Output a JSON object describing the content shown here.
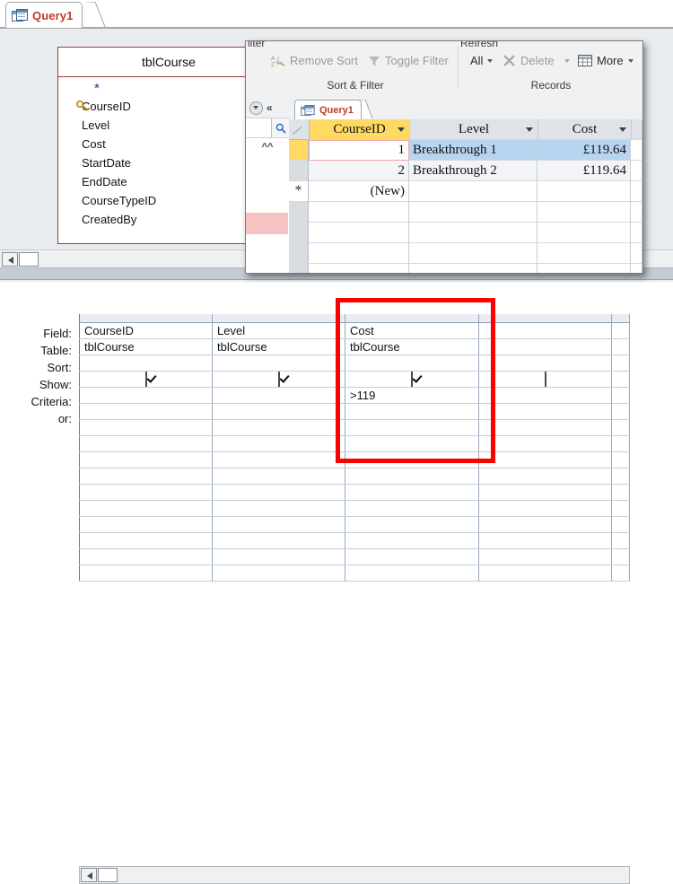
{
  "document_tab": {
    "label": "Query1",
    "icon": "query-icon"
  },
  "field_list": {
    "title": "tblCourse",
    "star": "*",
    "fields": [
      {
        "name": "CourseID",
        "primary_key": true
      },
      {
        "name": "Level",
        "primary_key": false
      },
      {
        "name": "Cost",
        "primary_key": false
      },
      {
        "name": "StartDate",
        "primary_key": false
      },
      {
        "name": "EndDate",
        "primary_key": false
      },
      {
        "name": "CourseTypeID",
        "primary_key": false
      },
      {
        "name": "CreatedBy",
        "primary_key": false
      }
    ]
  },
  "datasheet_window": {
    "ribbon": {
      "clipped_left_label": "ilter",
      "clipped_refresh_label": "Refresh",
      "sort_filter": {
        "group_label": "Sort & Filter",
        "remove_sort": "Remove Sort",
        "toggle_filter": "Toggle Filter"
      },
      "records": {
        "group_label": "Records",
        "refresh_all": "All",
        "delete": "Delete",
        "more": "More"
      }
    },
    "nav_pane": {
      "collapse_icon": "double-chevron-left-icon",
      "dropdown_icon": "nav-dropdown-icon",
      "search_icon": "search-icon",
      "collapse_group_icon": "double-chevron-up-icon"
    },
    "inner_tab": {
      "label": "Query1",
      "icon": "query-icon"
    },
    "grid": {
      "columns": [
        "CourseID",
        "Level",
        "Cost"
      ],
      "rows": [
        {
          "CourseID": "1",
          "Level": "Breakthrough 1",
          "Cost": "£119.64"
        },
        {
          "CourseID": "2",
          "Level": "Breakthrough 2",
          "Cost": "£119.64"
        }
      ],
      "new_row": "(New)",
      "new_row_marker": "*"
    }
  },
  "query_grid": {
    "row_labels": [
      "Field:",
      "Table:",
      "Sort:",
      "Show:",
      "Criteria:",
      "or:"
    ],
    "columns": [
      {
        "field": "CourseID",
        "table": "tblCourse",
        "sort": "",
        "show": true,
        "criteria": "",
        "or": ""
      },
      {
        "field": "Level",
        "table": "tblCourse",
        "sort": "",
        "show": true,
        "criteria": "",
        "or": ""
      },
      {
        "field": "Cost",
        "table": "tblCourse",
        "sort": "",
        "show": true,
        "criteria": ">119",
        "or": ""
      },
      {
        "field": "",
        "table": "",
        "sort": "",
        "show": false,
        "criteria": "",
        "or": ""
      },
      {
        "field": "",
        "table": "",
        "sort": "",
        "show": null,
        "criteria": "",
        "or": ""
      }
    ]
  },
  "annotation": {
    "type": "red-rectangle-highlight",
    "color": "#ff0000",
    "targets": "Cost column criteria"
  }
}
